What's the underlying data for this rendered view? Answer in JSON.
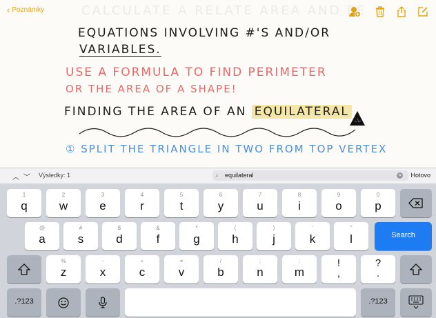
{
  "note": {
    "back_label": "Poznámky",
    "ghost_title": "CALCULATE A RELATE AREA AND PE",
    "lines": [
      "EQUATIONS  INVOLVING  #'S  AND/OR",
      "VARIABLES.",
      "USE  A  FORMULA  TO  FIND  PERIMETER",
      "OR  THE  AREA  OF  A  SHAPE!",
      "FINDING  THE  AREA  OF  AN",
      "EQUILATERAL",
      "① SPLIT  THE  TRIANGLE  IN  TWO  FROM  TOP  VERTEX"
    ]
  },
  "find": {
    "results_label": "Výsledky: 1",
    "query": "equilateral",
    "done_label": "Hotovo"
  },
  "keyboard": {
    "row1": [
      {
        "hint": "1",
        "ch": "q"
      },
      {
        "hint": "2",
        "ch": "w"
      },
      {
        "hint": "3",
        "ch": "e"
      },
      {
        "hint": "4",
        "ch": "r"
      },
      {
        "hint": "5",
        "ch": "t"
      },
      {
        "hint": "6",
        "ch": "y"
      },
      {
        "hint": "7",
        "ch": "u"
      },
      {
        "hint": "8",
        "ch": "i"
      },
      {
        "hint": "9",
        "ch": "o"
      },
      {
        "hint": "0",
        "ch": "p"
      }
    ],
    "row2": [
      {
        "hint": "@",
        "ch": "a"
      },
      {
        "hint": "#",
        "ch": "s"
      },
      {
        "hint": "$",
        "ch": "d"
      },
      {
        "hint": "&",
        "ch": "f"
      },
      {
        "hint": "*",
        "ch": "g"
      },
      {
        "hint": "(",
        "ch": "h"
      },
      {
        "hint": ")",
        "ch": "j"
      },
      {
        "hint": "'",
        "ch": "k"
      },
      {
        "hint": "\"",
        "ch": "l"
      }
    ],
    "row3": [
      {
        "hint": "%",
        "ch": "z"
      },
      {
        "hint": "-",
        "ch": "x"
      },
      {
        "hint": "+",
        "ch": "c"
      },
      {
        "hint": "=",
        "ch": "v"
      },
      {
        "hint": "/",
        "ch": "b"
      },
      {
        "hint": ";",
        "ch": "n"
      },
      {
        "hint": ":",
        "ch": "m"
      }
    ],
    "excl_key": "!\n,",
    "question_key": "?\n.",
    "search_label": "Search",
    "numbers_label": ".?123"
  },
  "colors": {
    "accent": "#e3a40f",
    "search_key": "#1e7cf2",
    "highlight": "#f4e6a6",
    "ink_red": "#e56a6a",
    "ink_blue": "#4a90d6"
  }
}
